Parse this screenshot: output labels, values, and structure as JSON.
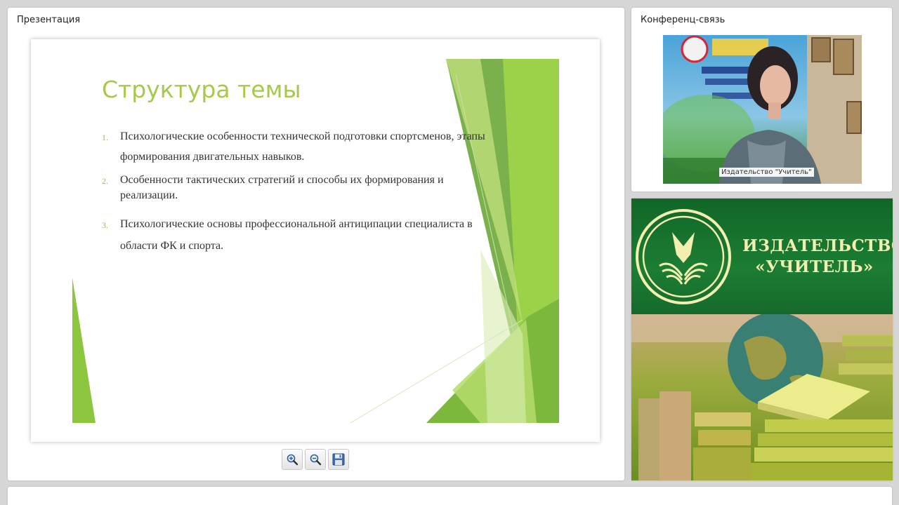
{
  "presentation": {
    "title": "Презентация",
    "slide": {
      "title": "Структура темы",
      "items": [
        {
          "number": "1.",
          "lines": [
            "Психологические особенности технической подготовки спортсменов, этапы",
            "формирования двигательных навыков."
          ]
        },
        {
          "number": "2.",
          "lines": [
            "Особенности тактических стратегий и способы их  формирования и",
            "реализации."
          ]
        },
        {
          "number": "3.",
          "lines": [
            "Психологические основы  профессиональной антиципации специалиста в",
            "области ФК и спорта."
          ]
        }
      ]
    },
    "toolbar": {
      "zoom_in": "zoom-in-icon",
      "zoom_out": "zoom-out-icon",
      "save": "floppy-disk-icon"
    }
  },
  "conference": {
    "title": "Конференц-связь",
    "participant_name": "Издательство \"Учитель\""
  },
  "publisher": {
    "line1": "ИЗДАТЕЛЬСТВО",
    "line2": "«УЧИТЕЛЬ»"
  },
  "colors": {
    "accent_green": "#a7c94a",
    "banner_green": "#1c7d33",
    "banner_text": "#f3efb0"
  }
}
